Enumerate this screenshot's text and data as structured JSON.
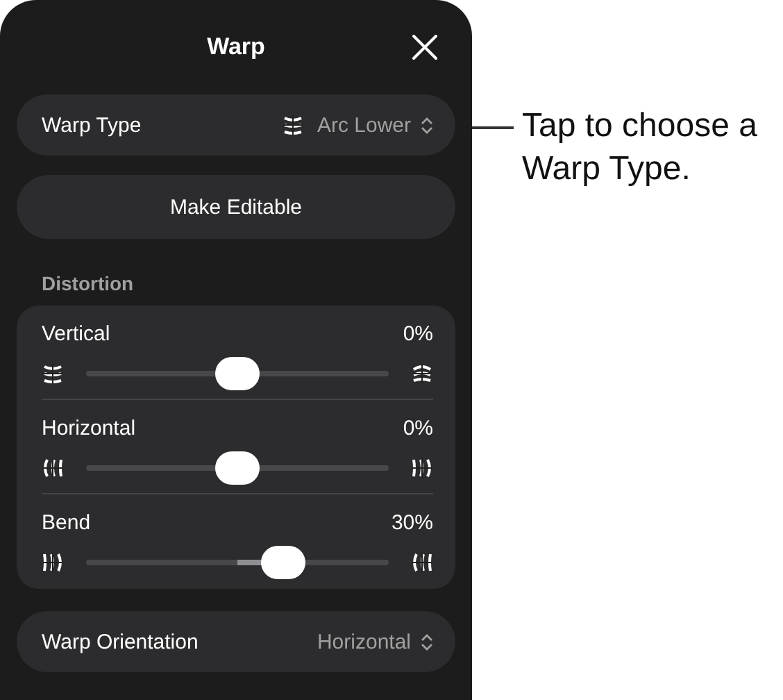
{
  "panel": {
    "title": "Warp"
  },
  "warp_type": {
    "label": "Warp Type",
    "value": "Arc Lower"
  },
  "make_editable": {
    "label": "Make Editable"
  },
  "distortion": {
    "heading": "Distortion",
    "sliders": [
      {
        "name": "Vertical",
        "reading": "0%",
        "level": 0.5
      },
      {
        "name": "Horizontal",
        "reading": "0%",
        "level": 0.5
      },
      {
        "name": "Bend",
        "reading": "30%",
        "level": 0.63
      }
    ]
  },
  "warp_orientation": {
    "label": "Warp Orientation",
    "value": "Horizontal"
  },
  "callout": {
    "text": "Tap to choose a Warp Type."
  }
}
